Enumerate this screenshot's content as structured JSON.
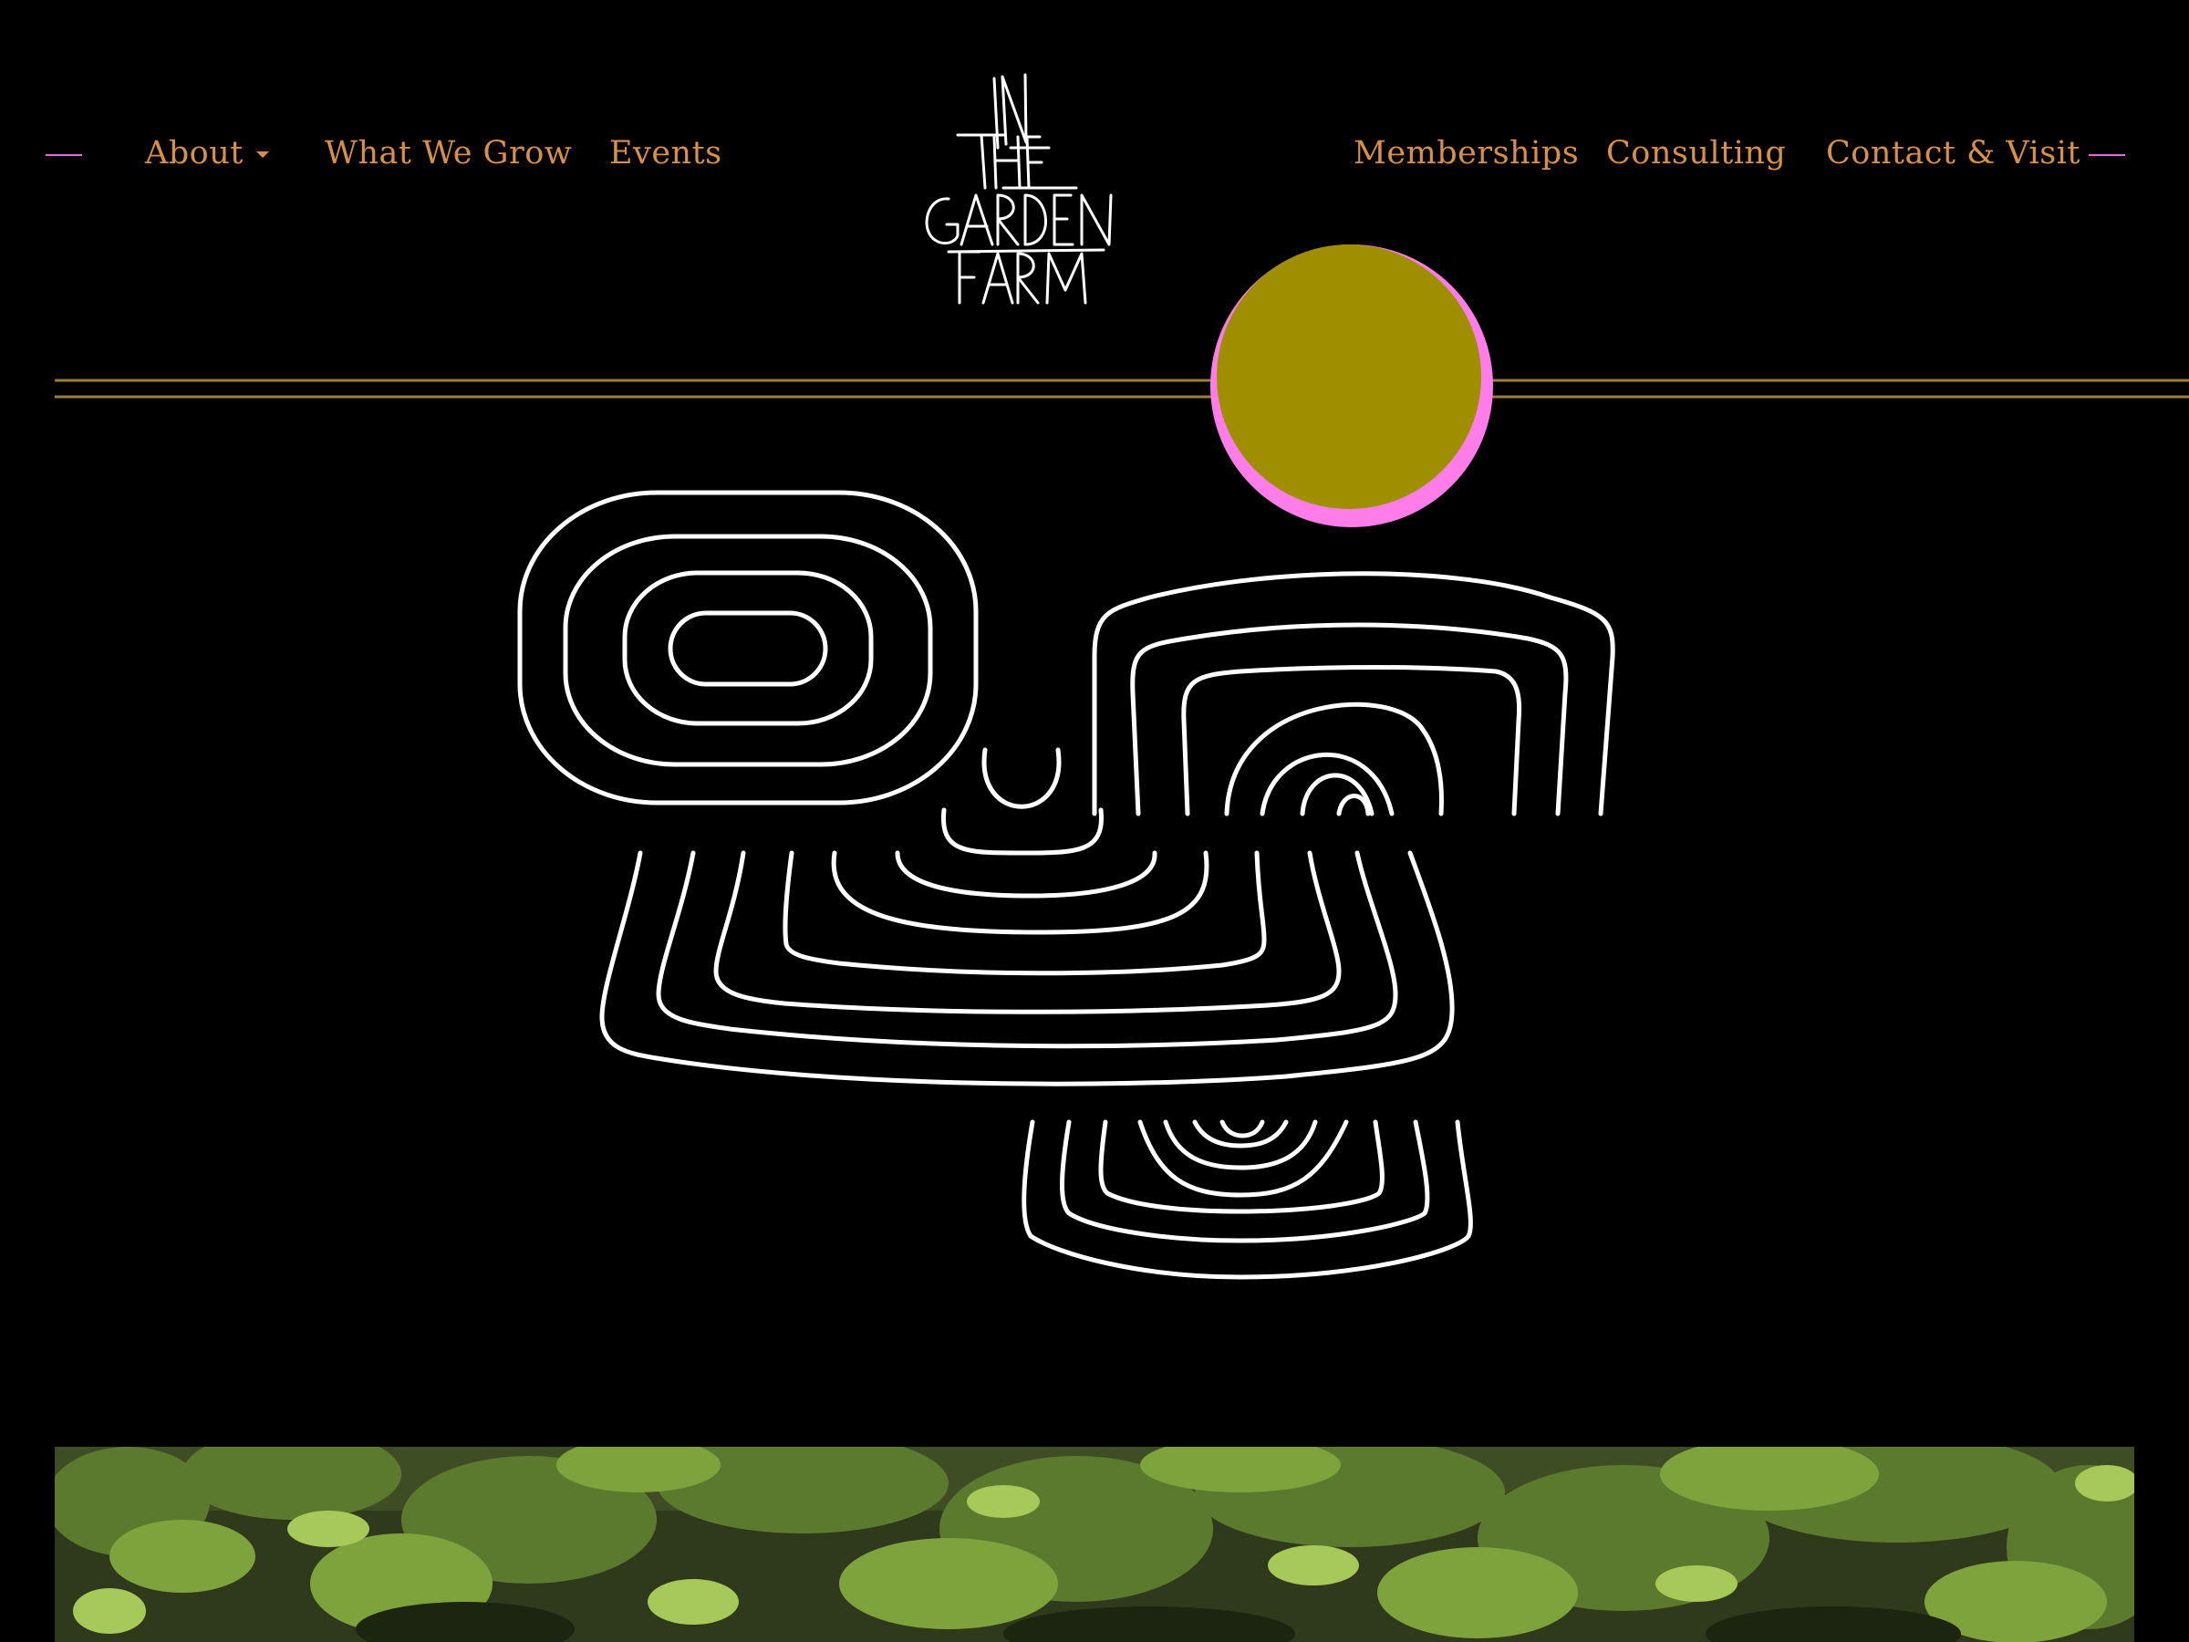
{
  "nav": {
    "left": [
      {
        "label": "About",
        "has_dropdown": true
      },
      {
        "label": "What We Grow"
      },
      {
        "label": "Events"
      }
    ],
    "right": [
      {
        "label": "Memberships"
      },
      {
        "label": "Consulting"
      },
      {
        "label": "Contact & Visit"
      }
    ]
  },
  "logo": {
    "lines": [
      "IN",
      "THE",
      "GARDEN",
      "FARM"
    ]
  },
  "colors": {
    "nav_text": "#d7904a",
    "dash": "#e06bd4",
    "horizon_line": "#9a7f34",
    "sun_fill": "#9f8f00",
    "sun_halo": "#ff7de8",
    "line_art": "#ffffff",
    "background": "#000000"
  },
  "hero": {
    "image": "garden-photo"
  }
}
